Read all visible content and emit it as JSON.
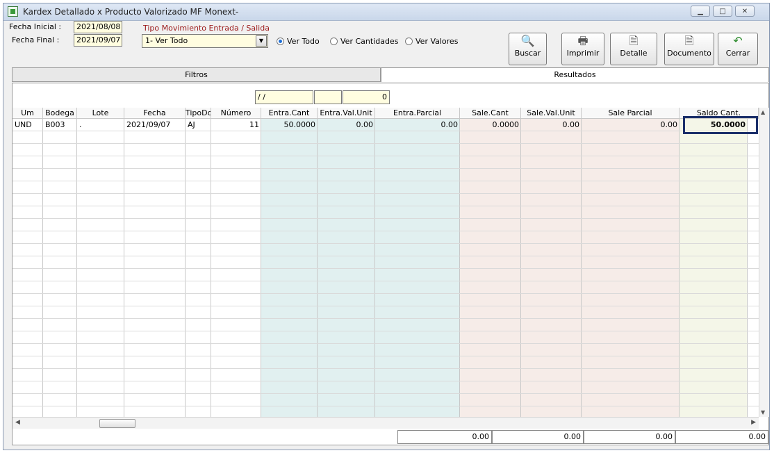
{
  "window": {
    "title": "Kardex Detallado x Producto Valorizado MF Monext-"
  },
  "filters": {
    "fecha_inicial_label": "Fecha Inicial :",
    "fecha_inicial_value": "2021/08/08",
    "fecha_final_label": "Fecha Final :",
    "fecha_final_value": "2021/09/07",
    "tipo_movimiento_label": "Tipo Movimiento  Entrada / Salida",
    "tipo_movimiento_value": "1- Ver Todo",
    "radios": [
      {
        "label": "Ver Todo",
        "selected": true
      },
      {
        "label": "Ver Cantidades",
        "selected": false
      },
      {
        "label": "Ver Valores",
        "selected": false
      }
    ]
  },
  "toolbar": {
    "buscar": "Buscar",
    "imprimir": "Imprimir",
    "detalle": "Detalle",
    "documento": "Documento",
    "cerrar": "Cerrar"
  },
  "tabs": {
    "filtros": "Filtros",
    "resultados": "Resultados"
  },
  "filter_row": {
    "date": "/ /",
    "count": "0"
  },
  "table": {
    "columns": [
      "Um",
      "Bodega",
      "Lote",
      "Fecha",
      "TipoDoc",
      "Número",
      "Entra.Cant",
      "Entra.Val.Unit",
      "Entra.Parcial",
      "Sale.Cant",
      "Sale.Val.Unit",
      "Sale Parcial",
      "Saldo Cant."
    ],
    "rows": [
      [
        "UND",
        "B003",
        ".",
        "2021/09/07",
        "AJ",
        "11",
        "50.0000",
        "0.00",
        "0.00",
        "0.0000",
        "0.00",
        "0.00",
        "50.0000"
      ]
    ]
  },
  "totals": [
    "0.00",
    "0.00",
    "0.00",
    "0.00"
  ],
  "colors": {
    "entra_bg": "#e1f0f0",
    "sale_bg": "#f6ece8",
    "saldo_bg": "#f4f6e8",
    "highlight_border": "#1b2f6a"
  }
}
